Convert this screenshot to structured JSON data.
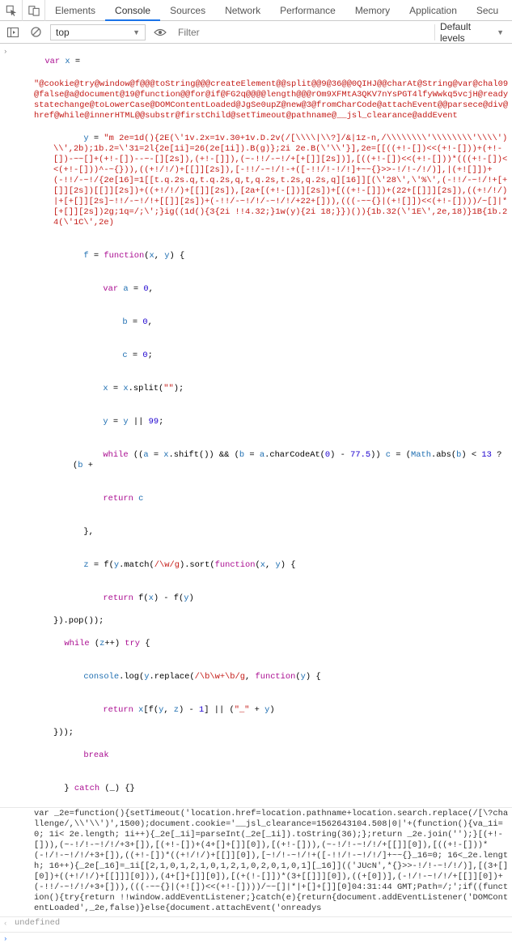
{
  "tabs": {
    "icons": [
      "elements-picker-icon",
      "device-icon"
    ],
    "items": [
      "Elements",
      "Console",
      "Sources",
      "Network",
      "Performance",
      "Memory",
      "Application",
      "Secu"
    ],
    "active": 1
  },
  "toolbar": {
    "context_label": "top",
    "filter_placeholder": "Filter",
    "level_label": "Default levels"
  },
  "code": {
    "l1_kw": "var",
    "l1_var": " x ",
    "l1_op": "=",
    "l2_str": "\"@cookie@try@window@f@@@toString@@@createElement@@split@@9@36@@0QIHJ@@charAt@String@var@chal09@false@a@document@19@function@@for@if@FG2q@@@@length@@@rOm9XFMtA3QKV7nYsPGT4lfyWwkq5vcjH@readystatechange@toLowerCase@DOMContentLoaded@JgSe0upZ@new@3@fromCharCode@attachEvent@@parsece@div@href@while@innerHTML@@substr@firstChild@setTimeout@pathname@__jsl_clearance@addEvent",
    "l3_var": "y",
    "l3_op": " = ",
    "l3_str": "\"m 2e=1d(){2E(\\'1v.2x=1v.30+1v.D.2v(/[\\\\\\\\|\\\\?]/&|1z-n,/\\\\\\\\\\\\\\\\'\\\\\\\\\\\\\\\\'\\\\\\\\')\\\\',2b);1b.2=\\'31=2l{2e[1i]=26(2e[1i]).B(g)};2i 2e.B(\\'\\\\'}],2e=[[((+!-[])<<(+!-[]))+(+!-[])-~~[]+(+!-[])--~-[][2s]),(+!-[]]),(~-!!/-~!/+[+[]][2s])],[((+!-[])<<(+!-[]))*(((+!-[])<<(+!-[]))^-~{})),((+!/!/)+[[]][2s]),[-!!/-~!/!-+([-!!/!-!/!]+~~{}>>-!/!-/!/)],|(+![]])+(-!!/-~!/{2e[16]=1[[t.q.2s.q,t.q.2s,q,t,q.2s,t.2s,q.2s,q][16]][(\\'28\\',\\'%\\',(-!!/-~!/!+[+[]][2s])[[]][2s])+((+!/!/)+[[]][2s]),[2a+[(+!-[])][2s])+[((+!-[]])+(22+[[]]][2s]),((+!/!/)|+[+[]][2s]~!!/-~!/!+[[]][2s])+(-!!/-~!/!/-~!/!/+22+[])),(((-~~{}|(+![]])<<(+!-[])))/~[]|*[+[]][2s])2g;1q=/;\\';}ig((1d(){3{2i !!4.32;}1w(y){2i 18;}})()){1b.32(\\'1E\\',2e,18)}1B{1b.24(\\'1C\\',2e)",
    "l4_var_f": "f",
    "l4_op": " = ",
    "l4_kw": "function",
    "l4_args": "(",
    "l4_arg1": "x",
    "l4_comma": ", ",
    "l4_arg2": "y",
    "l4_close": ") {",
    "l5_kw": "var",
    "l5_var": " a ",
    "l5_op": "= ",
    "l5_num": "0",
    "l5_end": ",",
    "l6_var": "b",
    "l6_rest": " = ",
    "l6_num": "0",
    "l6_end": ",",
    "l7_var": "c",
    "l7_rest": " = ",
    "l7_num": "0",
    "l7_end": ";",
    "l8_var": "x",
    "l8_rest": " = ",
    "l8_var2": "x",
    "l8_call": ".split(",
    "l8_str": "\"\"",
    "l8_call2": ");",
    "l9_var": "y",
    "l9_rest": " = ",
    "l9_var2": "y",
    "l9_or": " || ",
    "l9_num": "99",
    "l9_end": ";",
    "l10_kw": "while",
    "l10_open": " ((",
    "l10_a": "a",
    "l10_eq": " = ",
    "l10_x": "x",
    "l10_shift": ".shift()) ",
    "l10_and": "&&",
    "l10_open2": " (",
    "l10_b": "b",
    "l10_eq2": " = ",
    "l10_a2": "a",
    "l10_cc": ".charCodeAt(",
    "l10_zero": "0",
    "l10_close": ") - ",
    "l10_n77": "77.5",
    "l10_close2": ")) ",
    "l10_c": "c",
    "l10_eq3": " = (",
    "l10_math": "Math",
    "l10_abs": ".abs(",
    "l10_b2": "b",
    "l10_close3": ") < ",
    "l10_n13": "13",
    "l10_tern": " ? ",
    "l10_open3": "(",
    "l10_b3": "b",
    "l10_plus": " +",
    "l11_kw": "return",
    "l11_var": " c",
    "l12": "},",
    "l13_var": "z",
    "l13_rest": " = f(",
    "l13_y": "y",
    "l13_match": ".match(",
    "l13_re": "/\\w/g",
    "l13_close": ").sort(",
    "l13_kw": "function",
    "l13_args": "(",
    "l13_x": "x",
    "l13_comma": ", ",
    "l13_y2": "y",
    "l13_close2": ") {",
    "l14_kw": "return",
    "l14_rest": " f(",
    "l14_x": "x",
    "l14_close": ") - f(",
    "l14_y": "y",
    "l14_close2": ")",
    "l15": "}).pop());",
    "l16_kw": "while",
    "l16_open": " (",
    "l16_z": "z",
    "l16_inc": "++) ",
    "l16_try": "try",
    "l16_brace": " {",
    "l17_console": "console",
    "l17_log": ".log(",
    "l17_y": "y",
    "l17_replace": ".replace(",
    "l17_re": "/\\b\\w+\\b/g",
    "l17_comma": ", ",
    "l17_kw": "function",
    "l17_args": "(",
    "l17_y2": "y",
    "l17_close": ") {",
    "l18_kw": "return",
    "l18_rest": " ",
    "l18_x": "x",
    "l18_open": "[f(",
    "l18_y": "y",
    "l18_comma": ", ",
    "l18_z": "z",
    "l18_close": ") - ",
    "l18_one": "1",
    "l18_close2": "] ",
    "l18_or": "||",
    "l18_open2": " (",
    "l18_us": "\"_\"",
    "l18_plus": " + ",
    "l18_y2": "y",
    "l18_close3": ")",
    "l19": "}));",
    "l20_kw": "break",
    "l21_close": "} ",
    "l21_kw": "catch",
    "l21_args": " (_) {}",
    "out_text": "var _2e=function(){setTimeout('location.href=location.pathname+location.search.replace(/[\\?challenge/,\\\\'\\\\')',1500);document.cookie='__jsl_clearance=1562643104.508|0|'+(function(){va_1i=0; 1i< 2e.length; 1i++){_2e[_1i]=parseInt(_2e[_1i]).toString(36);};return _2e.join('');}[(+!-[])),(~-!/!-~!/!/+3+[]),[(+!-[])+(4+[]+[]][0]),[(+!-[])),(~-!/!-~!/!/+[[]][0]),[((+!-[]))*(-!/!-~!/!/+3+[]),((+!-[])*((+!/!/)+[[]][0]),[~!/!-~!/!+([-!!/!-~!/!/]+~~{}_16=0; 16<_2e.length; 16++){_2e[_16]=_1i[[2,1,0,1,2,1,0,1,2,1,0,2,0,1,0,1][_16]](('JUcN',*{}>>-!/!-~!/!/)],[(3+[][0])+((+!/!/)+[[]]][0])),(4+[]+[]][0]),[(+(!-[]])*(3+[[]]][0]),((+[0])],(-!/!-~!/!/+[[]][0])+(-!!/-~!/!/+3+[])),(((-~~{}|(+![])<<(+!-[])))/~~[]|*|+[]+[]][0]04:31:44 GMT;Path=/;';if((function(){try{return !!window.addEventListener;}catch(e){return{document.addEventListener('DOMContentLoaded',_2e,false)}else{document.attachEvent('onreadys",
    "undefined": "undefined"
  }
}
